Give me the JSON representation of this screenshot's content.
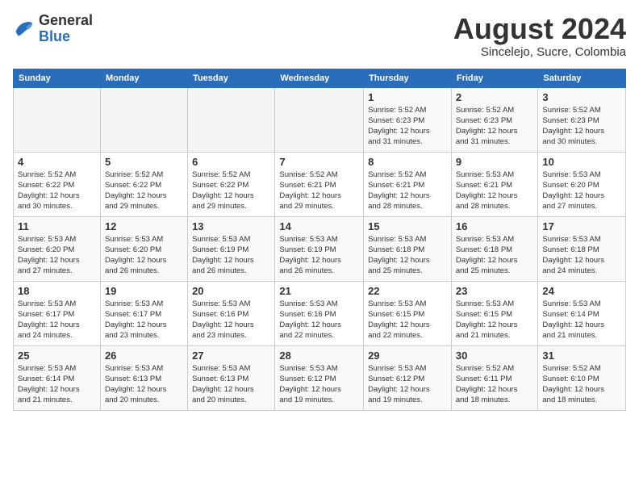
{
  "header": {
    "logo_general": "General",
    "logo_blue": "Blue",
    "month_year": "August 2024",
    "location": "Sincelejo, Sucre, Colombia"
  },
  "calendar": {
    "days_of_week": [
      "Sunday",
      "Monday",
      "Tuesday",
      "Wednesday",
      "Thursday",
      "Friday",
      "Saturday"
    ],
    "weeks": [
      [
        {
          "day": "",
          "info": ""
        },
        {
          "day": "",
          "info": ""
        },
        {
          "day": "",
          "info": ""
        },
        {
          "day": "",
          "info": ""
        },
        {
          "day": "1",
          "info": "Sunrise: 5:52 AM\nSunset: 6:23 PM\nDaylight: 12 hours\nand 31 minutes."
        },
        {
          "day": "2",
          "info": "Sunrise: 5:52 AM\nSunset: 6:23 PM\nDaylight: 12 hours\nand 31 minutes."
        },
        {
          "day": "3",
          "info": "Sunrise: 5:52 AM\nSunset: 6:23 PM\nDaylight: 12 hours\nand 30 minutes."
        }
      ],
      [
        {
          "day": "4",
          "info": "Sunrise: 5:52 AM\nSunset: 6:22 PM\nDaylight: 12 hours\nand 30 minutes."
        },
        {
          "day": "5",
          "info": "Sunrise: 5:52 AM\nSunset: 6:22 PM\nDaylight: 12 hours\nand 29 minutes."
        },
        {
          "day": "6",
          "info": "Sunrise: 5:52 AM\nSunset: 6:22 PM\nDaylight: 12 hours\nand 29 minutes."
        },
        {
          "day": "7",
          "info": "Sunrise: 5:52 AM\nSunset: 6:21 PM\nDaylight: 12 hours\nand 29 minutes."
        },
        {
          "day": "8",
          "info": "Sunrise: 5:52 AM\nSunset: 6:21 PM\nDaylight: 12 hours\nand 28 minutes."
        },
        {
          "day": "9",
          "info": "Sunrise: 5:53 AM\nSunset: 6:21 PM\nDaylight: 12 hours\nand 28 minutes."
        },
        {
          "day": "10",
          "info": "Sunrise: 5:53 AM\nSunset: 6:20 PM\nDaylight: 12 hours\nand 27 minutes."
        }
      ],
      [
        {
          "day": "11",
          "info": "Sunrise: 5:53 AM\nSunset: 6:20 PM\nDaylight: 12 hours\nand 27 minutes."
        },
        {
          "day": "12",
          "info": "Sunrise: 5:53 AM\nSunset: 6:20 PM\nDaylight: 12 hours\nand 26 minutes."
        },
        {
          "day": "13",
          "info": "Sunrise: 5:53 AM\nSunset: 6:19 PM\nDaylight: 12 hours\nand 26 minutes."
        },
        {
          "day": "14",
          "info": "Sunrise: 5:53 AM\nSunset: 6:19 PM\nDaylight: 12 hours\nand 26 minutes."
        },
        {
          "day": "15",
          "info": "Sunrise: 5:53 AM\nSunset: 6:18 PM\nDaylight: 12 hours\nand 25 minutes."
        },
        {
          "day": "16",
          "info": "Sunrise: 5:53 AM\nSunset: 6:18 PM\nDaylight: 12 hours\nand 25 minutes."
        },
        {
          "day": "17",
          "info": "Sunrise: 5:53 AM\nSunset: 6:18 PM\nDaylight: 12 hours\nand 24 minutes."
        }
      ],
      [
        {
          "day": "18",
          "info": "Sunrise: 5:53 AM\nSunset: 6:17 PM\nDaylight: 12 hours\nand 24 minutes."
        },
        {
          "day": "19",
          "info": "Sunrise: 5:53 AM\nSunset: 6:17 PM\nDaylight: 12 hours\nand 23 minutes."
        },
        {
          "day": "20",
          "info": "Sunrise: 5:53 AM\nSunset: 6:16 PM\nDaylight: 12 hours\nand 23 minutes."
        },
        {
          "day": "21",
          "info": "Sunrise: 5:53 AM\nSunset: 6:16 PM\nDaylight: 12 hours\nand 22 minutes."
        },
        {
          "day": "22",
          "info": "Sunrise: 5:53 AM\nSunset: 6:15 PM\nDaylight: 12 hours\nand 22 minutes."
        },
        {
          "day": "23",
          "info": "Sunrise: 5:53 AM\nSunset: 6:15 PM\nDaylight: 12 hours\nand 21 minutes."
        },
        {
          "day": "24",
          "info": "Sunrise: 5:53 AM\nSunset: 6:14 PM\nDaylight: 12 hours\nand 21 minutes."
        }
      ],
      [
        {
          "day": "25",
          "info": "Sunrise: 5:53 AM\nSunset: 6:14 PM\nDaylight: 12 hours\nand 21 minutes."
        },
        {
          "day": "26",
          "info": "Sunrise: 5:53 AM\nSunset: 6:13 PM\nDaylight: 12 hours\nand 20 minutes."
        },
        {
          "day": "27",
          "info": "Sunrise: 5:53 AM\nSunset: 6:13 PM\nDaylight: 12 hours\nand 20 minutes."
        },
        {
          "day": "28",
          "info": "Sunrise: 5:53 AM\nSunset: 6:12 PM\nDaylight: 12 hours\nand 19 minutes."
        },
        {
          "day": "29",
          "info": "Sunrise: 5:53 AM\nSunset: 6:12 PM\nDaylight: 12 hours\nand 19 minutes."
        },
        {
          "day": "30",
          "info": "Sunrise: 5:52 AM\nSunset: 6:11 PM\nDaylight: 12 hours\nand 18 minutes."
        },
        {
          "day": "31",
          "info": "Sunrise: 5:52 AM\nSunset: 6:10 PM\nDaylight: 12 hours\nand 18 minutes."
        }
      ]
    ]
  }
}
